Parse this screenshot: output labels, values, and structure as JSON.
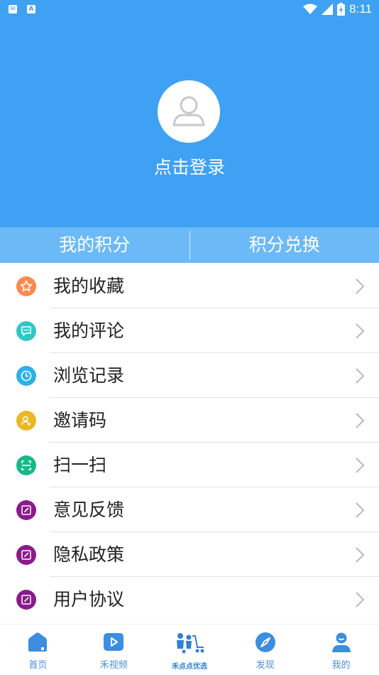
{
  "status_bar": {
    "time": "8:11"
  },
  "header": {
    "login_label": "点击登录"
  },
  "points": {
    "my_points": "我的积分",
    "exchange": "积分兑换"
  },
  "menu": [
    {
      "label": "我的收藏",
      "icon": "star-icon",
      "color": "#fb8a4c"
    },
    {
      "label": "我的评论",
      "icon": "comment-icon",
      "color": "#2ec9c7"
    },
    {
      "label": "浏览记录",
      "icon": "clock-icon",
      "color": "#2db0e8"
    },
    {
      "label": "邀请码",
      "icon": "invite-user-icon",
      "color": "#e9b925"
    },
    {
      "label": "扫一扫",
      "icon": "scan-icon",
      "color": "#19b887"
    },
    {
      "label": "意见反馈",
      "icon": "edit-icon",
      "color": "#8b1a8c"
    },
    {
      "label": "隐私政策",
      "icon": "edit-icon",
      "color": "#8b1a8c"
    },
    {
      "label": "用户协议",
      "icon": "edit-icon",
      "color": "#8b1a8c"
    }
  ],
  "tabs": [
    {
      "label": "首页",
      "icon": "home-icon"
    },
    {
      "label": "禾视频",
      "icon": "video-play-icon"
    },
    {
      "label": "禾点点优选",
      "icon": "shopping-cart-family-icon"
    },
    {
      "label": "发现",
      "icon": "compass-icon"
    },
    {
      "label": "我的",
      "icon": "user-profile-icon"
    }
  ],
  "colors": {
    "primary": "#3ea1f4",
    "points_bar": "#6cb9f7",
    "tab_text": "#4a8fd6"
  }
}
